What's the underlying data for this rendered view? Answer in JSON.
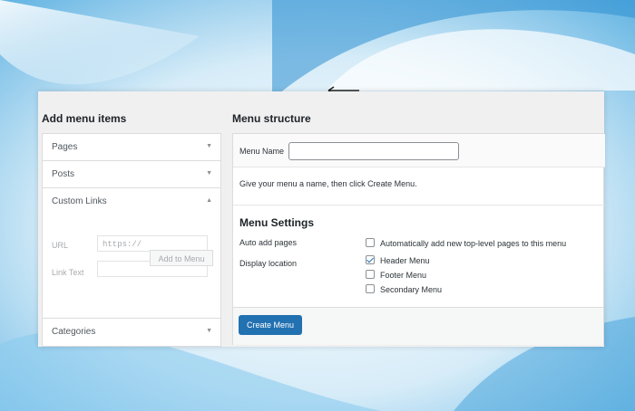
{
  "left": {
    "title": "Add menu items",
    "items": [
      {
        "label": "Pages",
        "arrow": "▼"
      },
      {
        "label": "Posts",
        "arrow": "▼"
      },
      {
        "label": "Custom Links",
        "arrow": "▲"
      },
      {
        "label": "Categories",
        "arrow": "▼"
      }
    ],
    "custom_links": {
      "url_label": "URL",
      "url_value": "https://",
      "link_text_label": "Link Text",
      "link_text_value": "",
      "add_button": "Add to Menu"
    }
  },
  "right": {
    "title": "Menu structure",
    "menu_name_label": "Menu Name",
    "menu_name_value": "",
    "hint": "Give your menu a name, then click Create Menu.",
    "settings_title": "Menu Settings",
    "auto_add_label": "Auto add pages",
    "auto_add_option": {
      "label": "Automatically add new top-level pages to this menu",
      "checked": false
    },
    "display_location_label": "Display location",
    "locations": [
      {
        "label": "Header Menu",
        "checked": true
      },
      {
        "label": "Footer Menu",
        "checked": false
      },
      {
        "label": "Secondary Menu",
        "checked": false
      }
    ],
    "create_button": "Create Menu"
  },
  "colors": {
    "primary": "#2271b1",
    "background_light": "#d9eef8",
    "background_dark": "#1f86c9"
  }
}
